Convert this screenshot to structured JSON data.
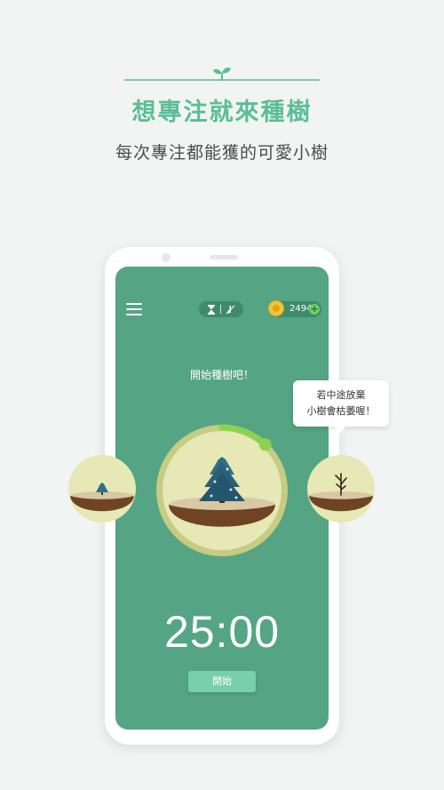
{
  "header": {
    "headline": "想專注就來種樹",
    "subline": "每次專注都能獲的可愛小樹"
  },
  "app": {
    "coins": "2494",
    "prompt": "開始種樹吧！",
    "timer": "25:00",
    "start_label": "開始",
    "growth_progress": 0.12
  },
  "bubble": {
    "line1": "若中途放棄",
    "line2": "小樹會枯萎喔！"
  },
  "colors": {
    "accent": "#5bbd98",
    "screen": "#55a484",
    "progress": "#8cd14f"
  },
  "icons": [
    "sprout-icon",
    "menu-icon",
    "hourglass-icon",
    "no-music-icon",
    "coin-icon",
    "plus-icon",
    "pine-tree-icon",
    "withered-tree-icon"
  ]
}
